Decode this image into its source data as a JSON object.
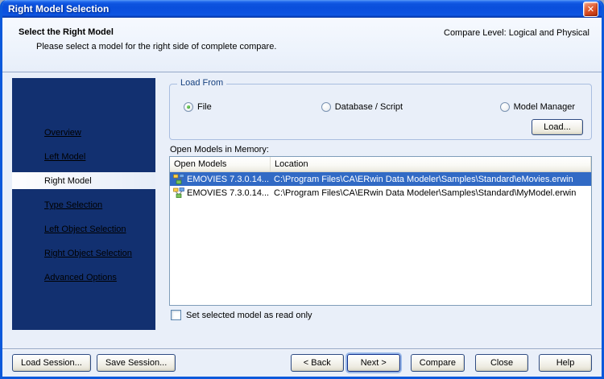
{
  "window": {
    "title": "Right Model Selection"
  },
  "icons": {
    "close": "✕"
  },
  "header": {
    "title": "Select the Right Model",
    "subtitle": "Please select a model for the right side of complete compare.",
    "compare_level": "Compare Level: Logical and Physical"
  },
  "sidebar": {
    "items": [
      {
        "label": "Overview",
        "active": false
      },
      {
        "label": "Left Model",
        "active": false
      },
      {
        "label": "Right Model",
        "active": true
      },
      {
        "label": "Type Selection",
        "active": false
      },
      {
        "label": "Left Object Selection",
        "active": false
      },
      {
        "label": "Right Object Selection",
        "active": false
      },
      {
        "label": "Advanced Options",
        "active": false
      }
    ]
  },
  "load_from": {
    "group_title": "Load From",
    "options": [
      {
        "label": "File",
        "selected": true
      },
      {
        "label": "Database / Script",
        "selected": false
      },
      {
        "label": "Model Manager",
        "selected": false
      }
    ],
    "load_button": "Load..."
  },
  "models": {
    "label": "Open Models in Memory:",
    "columns": [
      "Open Models",
      "Location"
    ],
    "rows": [
      {
        "name": "EMOVIES 7.3.0.14...",
        "location": "C:\\Program Files\\CA\\ERwin Data Modeler\\Samples\\Standard\\eMovies.erwin",
        "selected": true
      },
      {
        "name": "EMOVIES 7.3.0.14...",
        "location": "C:\\Program Files\\CA\\ERwin Data Modeler\\Samples\\Standard\\MyModel.erwin",
        "selected": false
      }
    ],
    "readonly_checkbox": "Set selected model as read only",
    "readonly_checked": false
  },
  "footer": {
    "left_buttons": [
      "Load Session...",
      "Save Session..."
    ],
    "right_buttons": [
      "< Back",
      "Next >",
      "Compare",
      "Close",
      "Help"
    ],
    "default_button": "Next >"
  },
  "colors": {
    "xp_frame": "#0C59DB",
    "titlebar_blue": "#0A4FDC",
    "sidebar_navy": "#123070",
    "body_bg": "#E9EFF9",
    "selection_blue": "#316AC5",
    "link_color": "#000000"
  }
}
